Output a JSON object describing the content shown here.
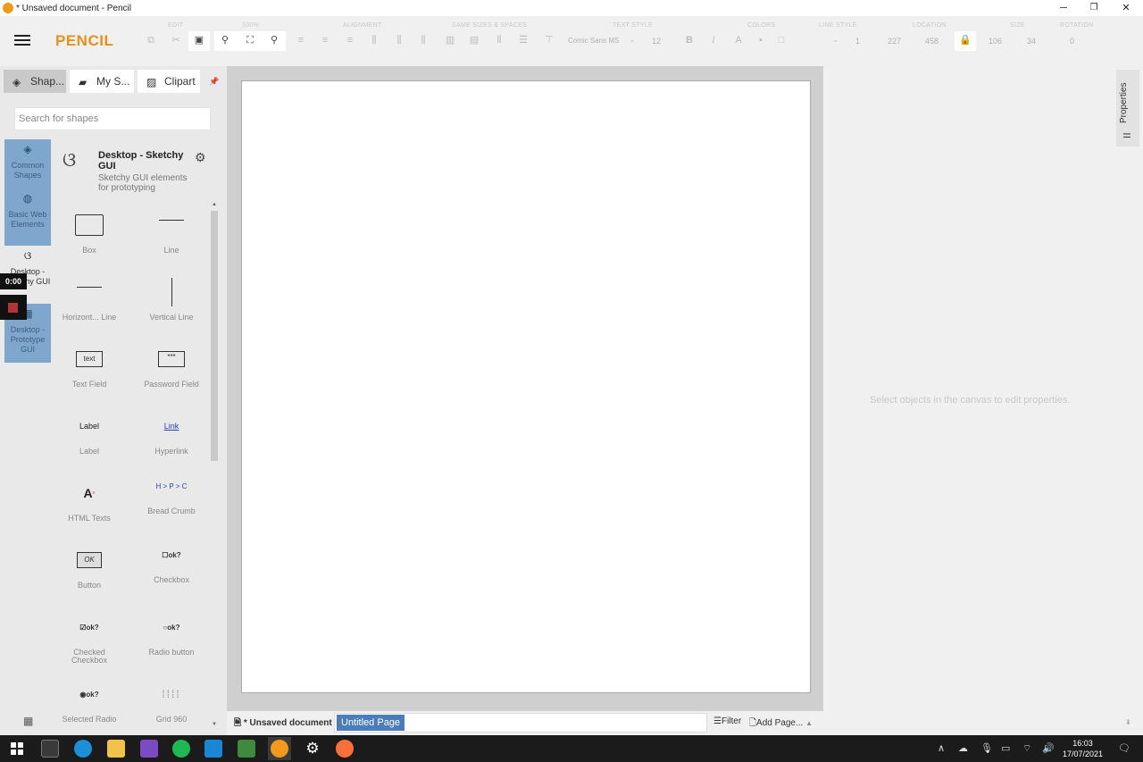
{
  "window": {
    "title": "* Unsaved document - Pencil",
    "minimize": "─",
    "restore": "❐",
    "close": "✕"
  },
  "app": {
    "logo": "PENCIL"
  },
  "toolbar": {
    "groups": [
      "EDIT",
      "100%",
      "ALIGNMENT",
      "SAME SIZES & SPACES",
      "TEXT STYLE",
      "COLORS",
      "LINE STYLE",
      "LOCATION",
      "SIZE",
      "ROTATION"
    ],
    "font_family": "Comic Sans MS",
    "font_size": "12",
    "line_width": "1",
    "loc_x": "227",
    "loc_y": "458",
    "size_w": "106",
    "size_h": "34",
    "rotation": "0"
  },
  "left_tabs": [
    {
      "label": "Shap...",
      "icon": "layers-icon"
    },
    {
      "label": "My S...",
      "icon": "briefcase-icon"
    },
    {
      "label": "Clipart",
      "icon": "image-icon"
    }
  ],
  "search": {
    "placeholder": "Search for shapes"
  },
  "categories": [
    {
      "label": "Common Shapes",
      "icon": "layers-icon"
    },
    {
      "label": "Basic Web Elements",
      "icon": "globe-icon"
    },
    {
      "label": "Desktop - Sketchy GUI",
      "icon": "squiggle-icon"
    },
    {
      "label": "Desktop - Prototype GUI",
      "icon": "window-icon"
    }
  ],
  "shelf": {
    "title": "Desktop - Sketchy GUI",
    "desc": "Sketchy GUI elements for prototyping"
  },
  "shapes": [
    "Box",
    "Line",
    "Horizont... Line",
    "Vertical Line",
    "Text Field",
    "Password Field",
    "Label",
    "Hyperlink",
    "HTML Texts",
    "Bread Crumb",
    "Button",
    "Checkbox",
    "Checked Checkbox",
    "Radio button",
    "Selected Radio",
    "Grid 960"
  ],
  "shape_previews": {
    "text_field": "text",
    "password": "***",
    "label": "Label",
    "link": "Link",
    "breadcrumb": "H > P > C",
    "button": "OK",
    "ok": "ok?"
  },
  "recording": {
    "timer": "0:00"
  },
  "properties": {
    "tab": "Properties",
    "hint": "Select objects in the canvas to edit properties."
  },
  "bottom": {
    "doc": "* Unsaved document",
    "page": "Untitled Page",
    "filter": "Filter",
    "add_page": "Add Page..."
  },
  "clock": {
    "time": "16:03",
    "date": "17/07/2021"
  },
  "colors": {
    "accent": "#e8901c",
    "category_selected": "#7fa6cc",
    "page_tab": "#4a7db9"
  }
}
